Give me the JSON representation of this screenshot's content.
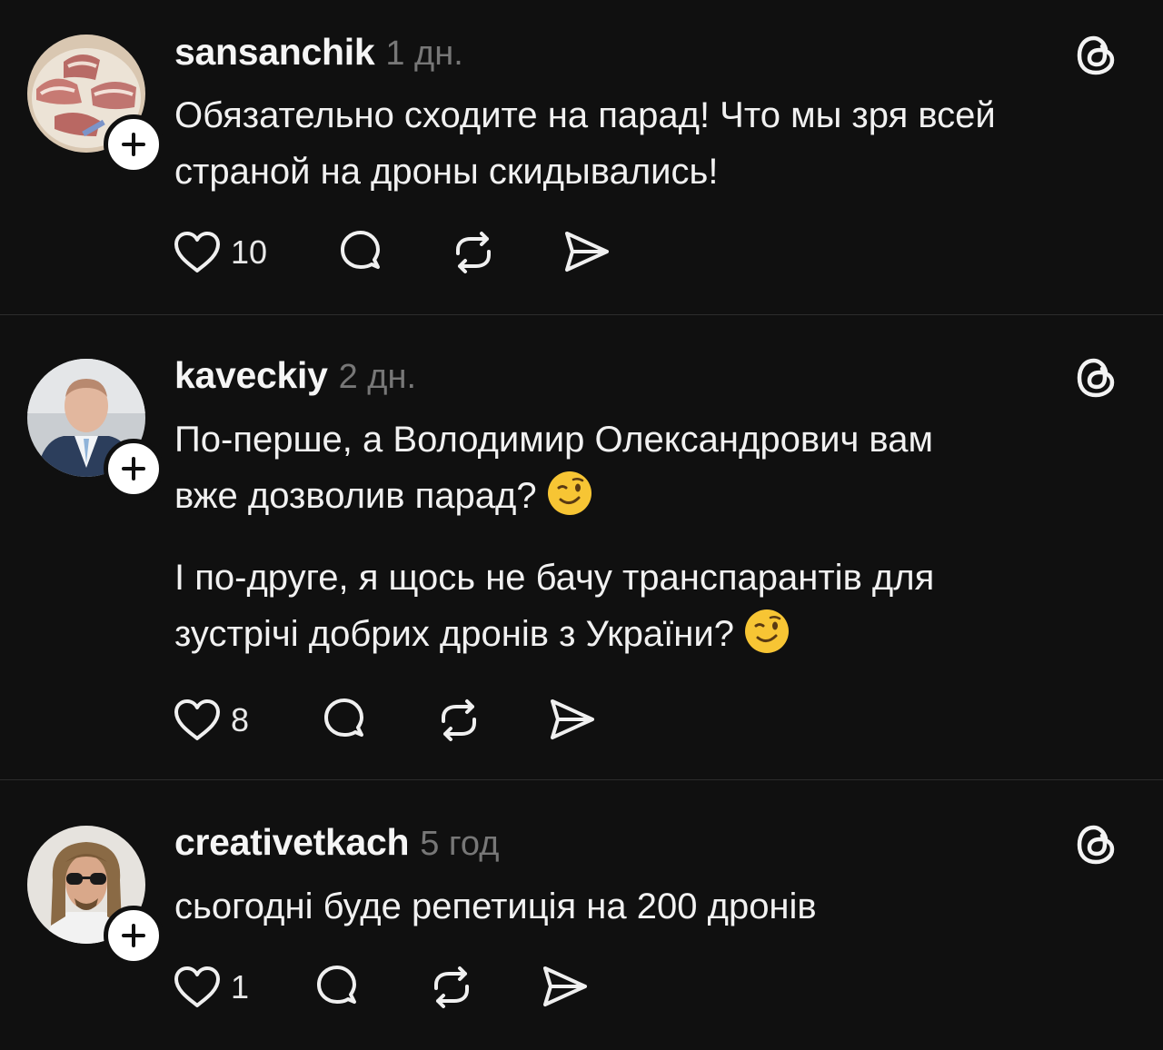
{
  "posts": [
    {
      "username": "sansanchik",
      "time": "1 дн.",
      "text": [
        "Обязательно сходите на парад! Что мы зря всей",
        "страной на дроны скидывались!"
      ],
      "likes": "10",
      "avatar": "bacon-photo"
    },
    {
      "username": "kaveckiy",
      "time": "2 дн.",
      "para1": [
        "По-перше, а Володимир Олександрович вам",
        "вже дозволив парад?"
      ],
      "para2": [
        "І по-друге, я щось не бачу транспарантів для",
        "зустрічі добрих дронів з України?"
      ],
      "likes": "8",
      "avatar": "man-in-suit-photo"
    },
    {
      "username": "creativetkach",
      "time": "5 год",
      "text": [
        "сьогодні буде репетиція на 200 дронів"
      ],
      "likes": "1",
      "avatar": "man-with-sunglasses-photo"
    }
  ],
  "icons": {
    "like": "heart-icon",
    "reply": "comment-icon",
    "repost": "repost-icon",
    "share": "send-icon",
    "brand": "threads-logo-icon",
    "follow": "plus-icon",
    "emoji": "winking-face-emoji"
  },
  "colors": {
    "background": "#101010",
    "text": "#f1f1f1",
    "muted": "#777777",
    "divider": "#2c2c2c"
  }
}
